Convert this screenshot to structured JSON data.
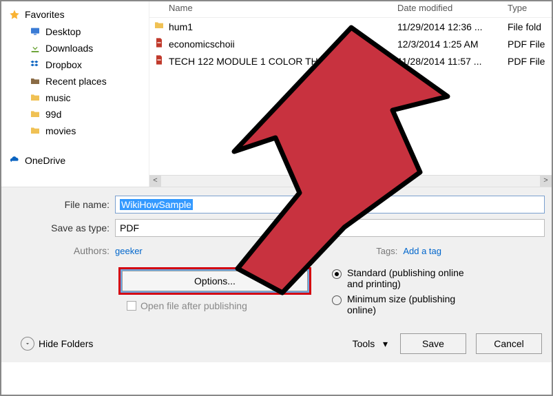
{
  "sidebar": {
    "favorites_label": "Favorites",
    "items": [
      {
        "label": "Desktop",
        "icon": "desktop-icon"
      },
      {
        "label": "Downloads",
        "icon": "downloads-icon"
      },
      {
        "label": "Dropbox",
        "icon": "dropbox-icon"
      },
      {
        "label": "Recent places",
        "icon": "recent-icon"
      },
      {
        "label": "music",
        "icon": "folder-icon"
      },
      {
        "label": "99d",
        "icon": "folder-icon"
      },
      {
        "label": "movies",
        "icon": "folder-icon"
      }
    ],
    "onedrive_label": "OneDrive"
  },
  "columns": {
    "name": "Name",
    "date": "Date modified",
    "type": "Type"
  },
  "files": [
    {
      "name": "hum1",
      "date": "11/29/2014 12:36 ...",
      "type": "File fold",
      "icon": "folder"
    },
    {
      "name": "economicschoii",
      "date": "12/3/2014 1:25 AM",
      "type": "PDF File",
      "icon": "pdf"
    },
    {
      "name": "TECH 122 MODULE 1 COLOR THEORIES(2)",
      "date": "11/28/2014 11:57 ...",
      "type": "PDF File",
      "icon": "pdf"
    }
  ],
  "form": {
    "filename_label": "File name:",
    "filename_value": "WikiHowSample",
    "saveastype_label": "Save as type:",
    "saveastype_value": "PDF",
    "authors_label": "Authors:",
    "authors_value": "geeker",
    "tags_label": "Tags:",
    "tags_value": "Add a tag"
  },
  "publish": {
    "options_button": "Options...",
    "open_after": "Open file after publishing",
    "standard": "Standard (publishing online and printing)",
    "minimum": "Minimum size (publishing online)"
  },
  "footer": {
    "hide_folders": "Hide Folders",
    "tools": "Tools",
    "save": "Save",
    "cancel": "Cancel"
  }
}
